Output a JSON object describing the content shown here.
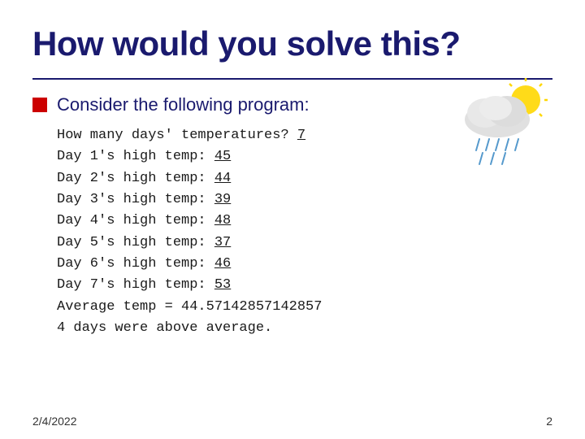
{
  "title": "How would you solve this?",
  "bullet": "Consider the following program:",
  "code": {
    "line0": "How many days' temperatures? 7",
    "line0_num": "7",
    "line1": "Day 1's high temp: 45",
    "line2": "Day 2's high temp: 44",
    "line3": "Day 3's high temp: 39",
    "line4": "Day 4's high temp: 48",
    "line5": "Day 5's high temp: 37",
    "line6": "Day 6's high temp: 46",
    "line7": "Day 7's high temp: 53",
    "line8": "Average temp = 44.571428571428​57",
    "line9": "4 days were above average.",
    "values": [
      "45",
      "44",
      "39",
      "48",
      "37",
      "46",
      "53"
    ]
  },
  "footer": {
    "date": "2/4/2022",
    "page": "2"
  }
}
